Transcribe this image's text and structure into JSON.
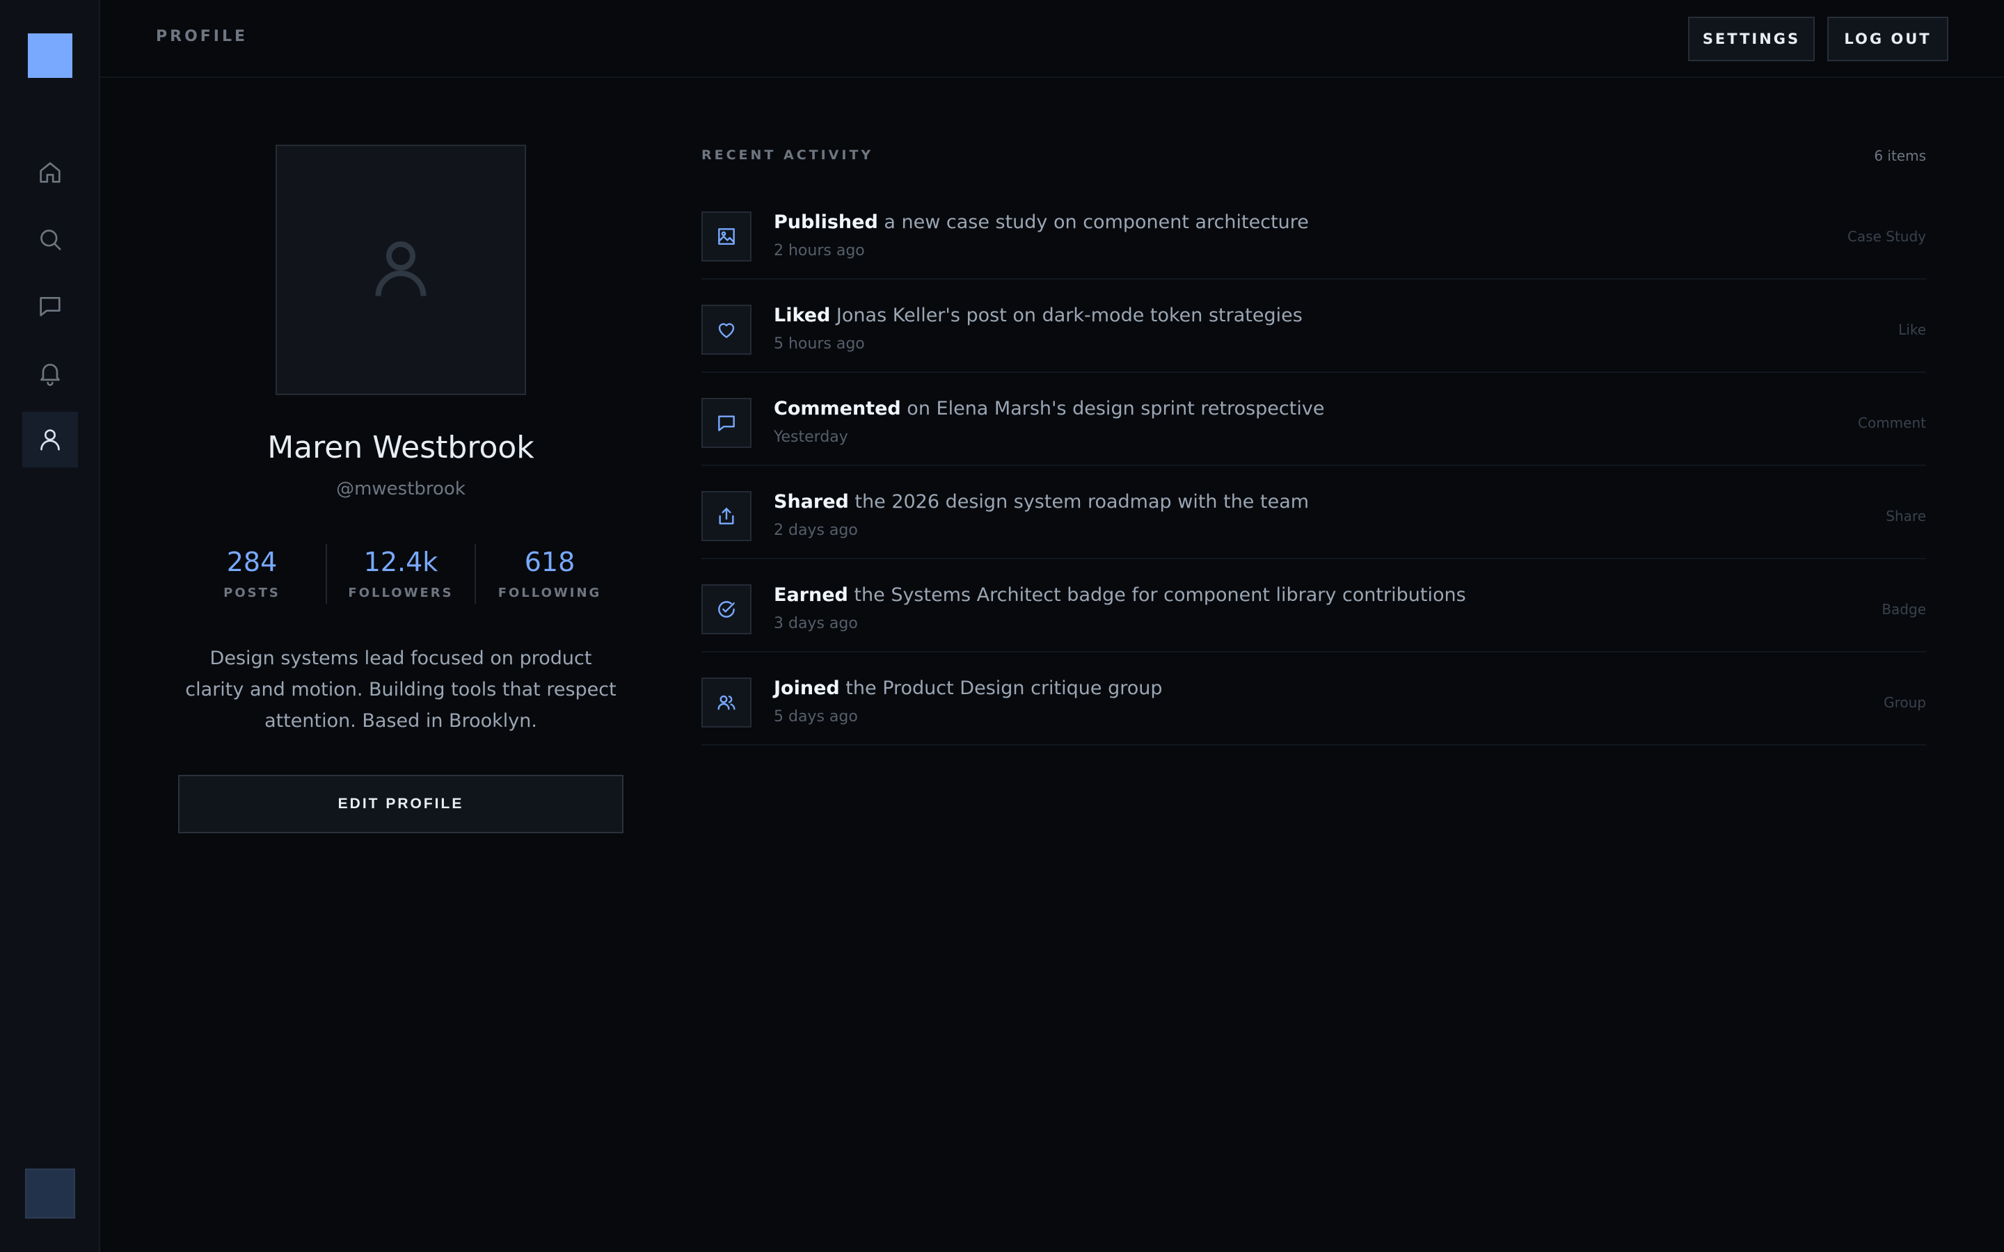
{
  "header": {
    "title": "PROFILE",
    "settings_label": "SETTINGS",
    "logout_label": "LOG OUT"
  },
  "sidebar": {
    "items": [
      {
        "icon": "home-icon",
        "active": false
      },
      {
        "icon": "search-icon",
        "active": false
      },
      {
        "icon": "message-icon",
        "active": false
      },
      {
        "icon": "bell-icon",
        "active": false
      },
      {
        "icon": "user-icon",
        "active": true
      }
    ]
  },
  "profile": {
    "name": "Maren Westbrook",
    "handle": "@mwestbrook",
    "stats": [
      {
        "value": "284",
        "label": "POSTS"
      },
      {
        "value": "12.4k",
        "label": "FOLLOWERS"
      },
      {
        "value": "618",
        "label": "FOLLOWING"
      }
    ],
    "bio": "Design systems lead focused on product clarity and motion. Building tools that respect attention. Based in Brooklyn.",
    "edit_label": "EDIT PROFILE"
  },
  "activity": {
    "heading": "RECENT ACTIVITY",
    "count": "6 items",
    "items": [
      {
        "icon": "image-icon",
        "verb": "Published",
        "text": " a new case study on component architecture",
        "time": "2 hours ago",
        "tag": "Case Study"
      },
      {
        "icon": "heart-icon",
        "verb": "Liked",
        "text": " Jonas Keller's post on dark-mode token strategies",
        "time": "5 hours ago",
        "tag": "Like"
      },
      {
        "icon": "comment-icon",
        "verb": "Commented",
        "text": " on Elena Marsh's design sprint retrospective",
        "time": "Yesterday",
        "tag": "Comment"
      },
      {
        "icon": "share-icon",
        "verb": "Shared",
        "text": " the 2026 design system roadmap with the team",
        "time": "2 days ago",
        "tag": "Share"
      },
      {
        "icon": "badge-check-icon",
        "verb": "Earned",
        "text": " the Systems Architect badge for component library contributions",
        "time": "3 days ago",
        "tag": "Badge"
      },
      {
        "icon": "users-icon",
        "verb": "Joined",
        "text": " the Product Design critique group",
        "time": "5 days ago",
        "tag": "Group"
      }
    ]
  },
  "colors": {
    "accent": "#79a9ff",
    "background": "#07090d",
    "sidebar": "#0d1117"
  }
}
